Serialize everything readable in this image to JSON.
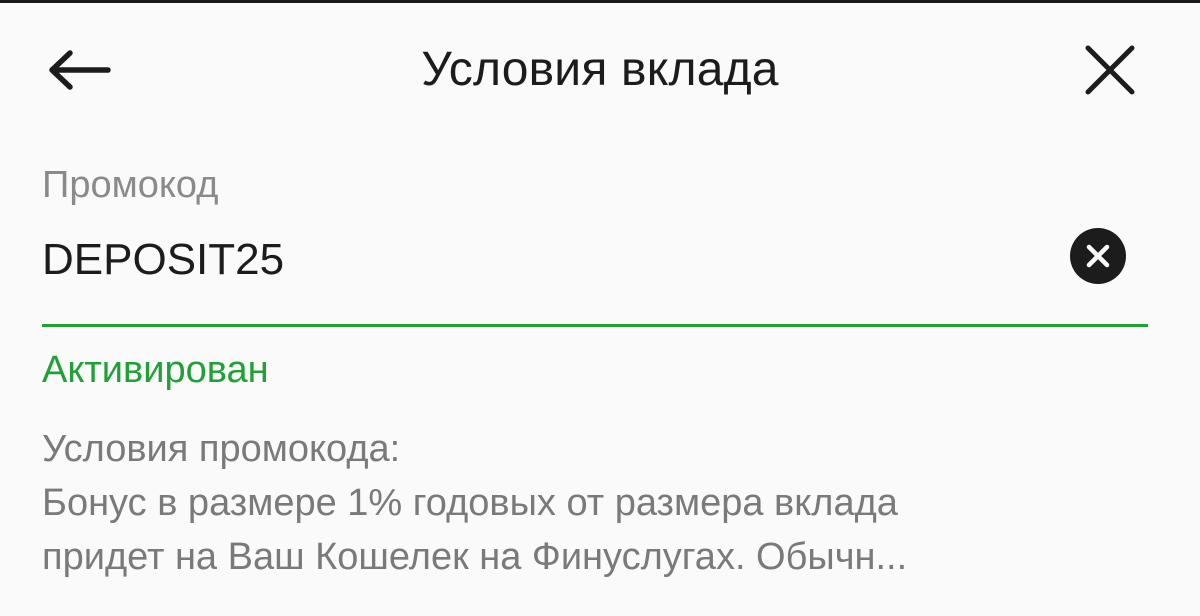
{
  "header": {
    "title": "Условия вклада",
    "back_icon": "arrow-left-icon",
    "close_icon": "close-icon"
  },
  "promo": {
    "label": "Промокод",
    "value": "DEPOSIT25",
    "clear_icon": "clear-circle-icon",
    "status": "Активирован"
  },
  "terms": {
    "heading": "Условия промокода:",
    "line1": "Бонус в размере 1% годовых от размера вклада",
    "line2": "придет на Ваш Кошелек на Финуслугах. Обычн..."
  },
  "colors": {
    "accent": "#21a038",
    "text_primary": "#1c1c1c",
    "text_secondary": "#7a7a7a"
  }
}
